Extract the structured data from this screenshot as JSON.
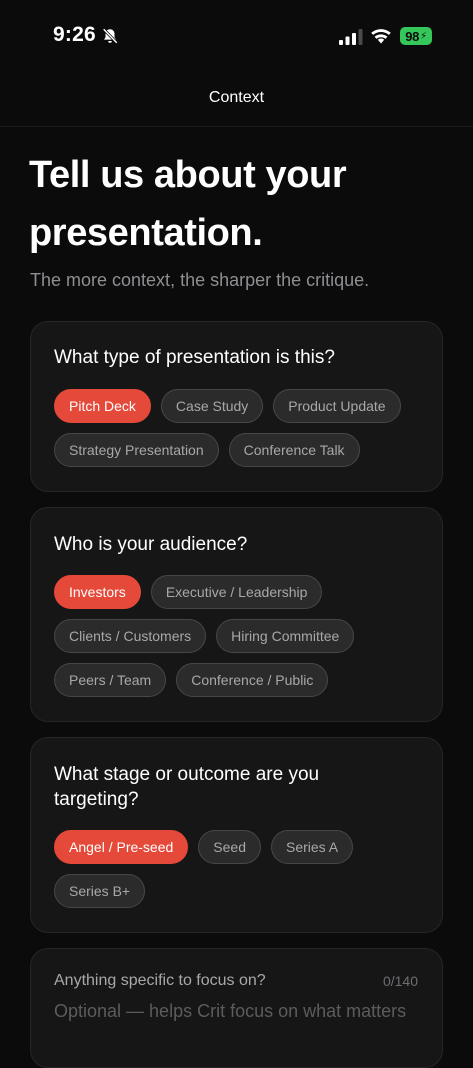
{
  "status": {
    "time": "9:26",
    "battery": "98"
  },
  "nav": {
    "title": "Context"
  },
  "header": {
    "title": "Tell us about your presentation.",
    "subtitle": "The more context, the sharper the critique."
  },
  "questions": [
    {
      "question": "What type of presentation is this?",
      "options": [
        "Pitch Deck",
        "Case Study",
        "Product Update",
        "Strategy Presentation",
        "Conference Talk"
      ],
      "selected": "Pitch Deck"
    },
    {
      "question": "Who is your audience?",
      "options": [
        "Investors",
        "Executive / Leadership",
        "Clients / Customers",
        "Hiring Committee",
        "Peers / Team",
        "Conference / Public"
      ],
      "selected": "Investors"
    },
    {
      "question": "What stage or outcome are you targeting?",
      "options": [
        "Angel / Pre-seed",
        "Seed",
        "Series A",
        "Series B+"
      ],
      "selected": "Angel / Pre-seed"
    }
  ],
  "focus": {
    "label": "Anything specific to focus on?",
    "counter": "0/140",
    "placeholder": "Optional — helps Crit focus on what matters"
  },
  "colors": {
    "accent": "#e5493a",
    "battery": "#35c759",
    "background": "#0b0b0b"
  }
}
